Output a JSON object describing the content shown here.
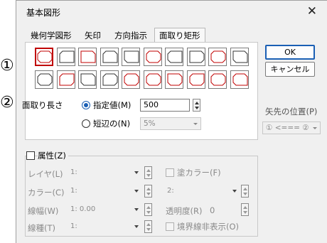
{
  "dialog": {
    "title": "基本図形",
    "close": "✕"
  },
  "tabs": [
    {
      "label": "幾何学図形",
      "active": false
    },
    {
      "label": "矢印",
      "active": false
    },
    {
      "label": "方向指示",
      "active": false
    },
    {
      "label": "面取り矩形",
      "active": true
    }
  ],
  "shapes": {
    "rows": 2,
    "cols": 10,
    "selected_index": 0,
    "accent": "#c00000"
  },
  "chamfer": {
    "label": "面取り長さ",
    "option_specified": "指定値(M)",
    "value": "500",
    "option_short": "短辺の(N)",
    "short_value": "5%"
  },
  "buttons": {
    "ok": "OK",
    "cancel": "キャンセル"
  },
  "arrow_position": {
    "label": "矢先の位置(P)",
    "value": "① <=== ②"
  },
  "attributes": {
    "label": "属性(Z)",
    "layer_label": "レイヤ(L)",
    "layer_value": "1:",
    "color_label": "カラー(C)",
    "color_value": "1:",
    "fill_label": "塗カラー(F)",
    "fill_value": "2:",
    "linewidth_label": "線幅(W)",
    "linewidth_value": "1: 0.00",
    "transparency_label": "透明度(R)",
    "transparency_value": "0",
    "linetype_label": "線種(T)",
    "linetype_value": "1:",
    "hide_border_label": "境界線非表示(O)"
  },
  "callouts": {
    "one": "①",
    "two": "②"
  }
}
